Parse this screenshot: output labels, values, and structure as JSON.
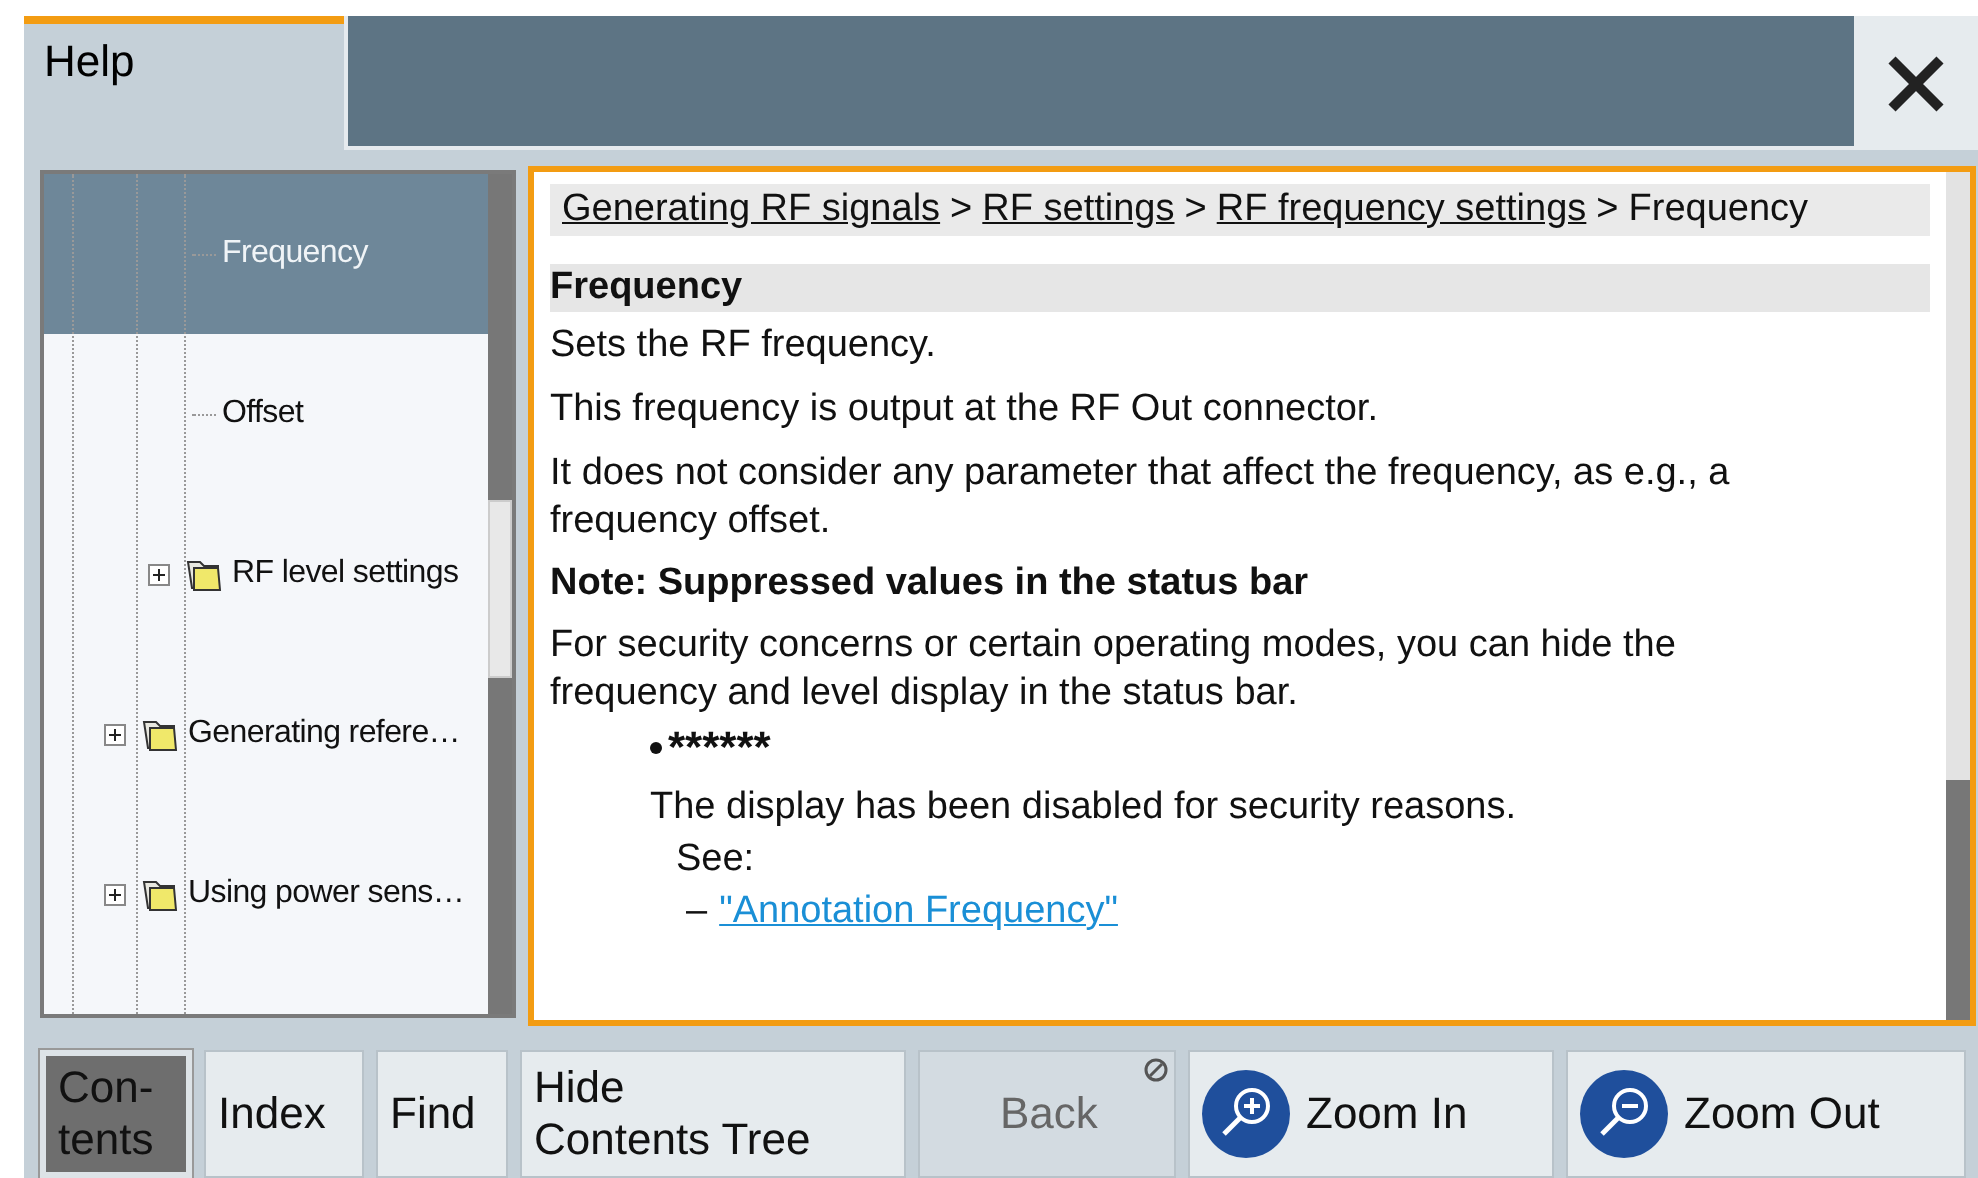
{
  "window": {
    "title": "Help"
  },
  "tree": [
    {
      "children": [
        {
          "children": [
            {
              "label": "Frequency",
              "selected": true,
              "folder": false
            },
            {
              "label": "Offset",
              "selected": false,
              "folder": false
            }
          ]
        },
        {
          "label": "RF level settings",
          "selected": false,
          "folder": true,
          "expanded": false
        }
      ]
    },
    {
      "label": "Generating refere…",
      "selected": false,
      "folder": true,
      "expanded": false
    },
    {
      "label": "Using power sens…",
      "selected": false,
      "folder": true,
      "expanded": false
    }
  ],
  "breadcrumb": [
    {
      "text": "Generating RF signals",
      "link": true
    },
    {
      "text": ">",
      "link": false
    },
    {
      "text": "RF settings",
      "link": true
    },
    {
      "text": ">",
      "link": false
    },
    {
      "text": "RF frequency settings",
      "link": true
    },
    {
      "text": ">",
      "link": false
    },
    {
      "text": "Frequency",
      "link": false
    }
  ],
  "content": [
    {
      "kind": "heading",
      "text": "Frequency"
    },
    {
      "kind": "para",
      "text": "Sets the RF frequency."
    },
    {
      "kind": "para",
      "text": "This frequency is output at the RF Out connector."
    },
    {
      "kind": "para",
      "text": "It does not consider any parameter that affect the frequency, as e.g., a frequency offset."
    },
    {
      "kind": "note",
      "text": "Note: Suppressed values in the status bar"
    },
    {
      "kind": "para",
      "text": "For security concerns or certain operating modes, you can hide the frequency and level display in the status bar."
    },
    {
      "kind": "bullet",
      "text": "******"
    },
    {
      "kind": "subpara",
      "text": "The display has been disabled for security reasons."
    },
    {
      "kind": "see",
      "text": "See:"
    },
    {
      "kind": "link",
      "dash": "–",
      "text": "\"Annotation Frequency\""
    }
  ],
  "buttons": [
    {
      "label": "Con-\ntents",
      "kind": "tab",
      "selected": true,
      "disabled": false
    },
    {
      "label": "Index",
      "kind": "tab",
      "selected": false,
      "disabled": false
    },
    {
      "label": "Find",
      "kind": "tab",
      "selected": false,
      "disabled": false
    },
    {
      "label": "Hide\nContents Tree",
      "kind": "plain",
      "selected": false,
      "disabled": false
    },
    {
      "label": "Back",
      "kind": "back",
      "selected": false,
      "disabled": true
    },
    {
      "label": "Zoom In",
      "kind": "zoom-in",
      "selected": false,
      "disabled": false
    },
    {
      "label": "Zoom Out",
      "kind": "zoom-out",
      "selected": false,
      "disabled": false
    }
  ]
}
